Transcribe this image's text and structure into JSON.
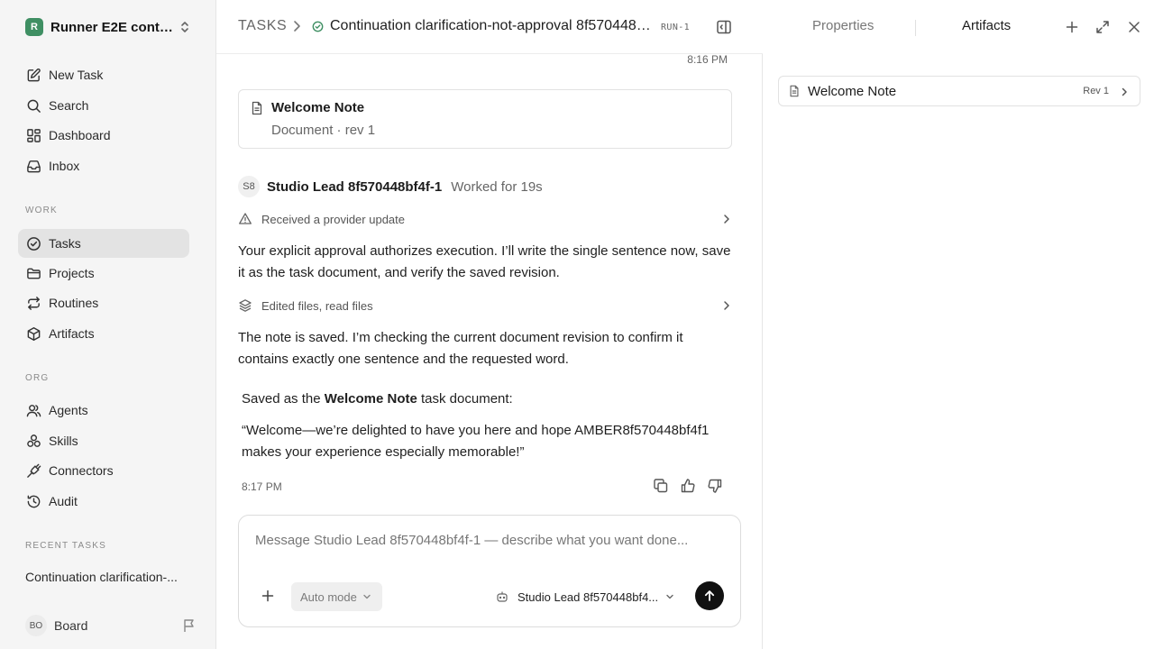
{
  "sidebar": {
    "workspace": {
      "logo": "R",
      "name": "Runner E2E conti..."
    },
    "primary": [
      {
        "label": "New Task",
        "icon": "edit-icon"
      },
      {
        "label": "Search",
        "icon": "search-icon"
      },
      {
        "label": "Dashboard",
        "icon": "dashboard-icon"
      },
      {
        "label": "Inbox",
        "icon": "inbox-icon"
      }
    ],
    "work_label": "WORK",
    "work": [
      {
        "label": "Tasks",
        "icon": "check-circle-icon",
        "active": true
      },
      {
        "label": "Projects",
        "icon": "folder-icon"
      },
      {
        "label": "Routines",
        "icon": "repeat-icon"
      },
      {
        "label": "Artifacts",
        "icon": "cube-icon"
      }
    ],
    "org_label": "ORG",
    "org": [
      {
        "label": "Agents",
        "icon": "users-icon"
      },
      {
        "label": "Skills",
        "icon": "skills-icon"
      },
      {
        "label": "Connectors",
        "icon": "plug-icon"
      },
      {
        "label": "Audit",
        "icon": "history-icon"
      }
    ],
    "recent_label": "RECENT TASKS",
    "recent": [
      "Continuation clarification-..."
    ],
    "user": {
      "initials": "BO",
      "name": "Board"
    }
  },
  "topbar": {
    "root": "TASKS",
    "title": "Continuation clarification-not-approval 8f570448bf4...",
    "run_badge": "RUN-1"
  },
  "thread": {
    "time_top": "8:16 PM",
    "doc_card": {
      "title": "Welcome Note",
      "meta": "Document · rev 1"
    },
    "agent": {
      "initials": "S8",
      "name": "Studio Lead 8f570448bf4f-1",
      "worked": "Worked for 19s"
    },
    "event1": "Received a provider update",
    "para1": "Your explicit approval authorizes execution. I’ll write the single sentence now, save it as the task document, and verify the saved revision.",
    "event2": "Edited files, read files",
    "para2": "The note is saved. I’m checking the current document revision to confirm it contains exactly one sentence and the requested word.",
    "saved_prefix": "Saved as the ",
    "saved_bold": "Welcome Note",
    "saved_suffix": " task document:",
    "quote": "“Welcome—we’re delighted to have you here and hope AMBER8f570448bf4f1 makes your experience especially memorable!”",
    "time_bottom": "8:17 PM"
  },
  "composer": {
    "placeholder": "Message Studio Lead 8f570448bf4f-1 — describe what you want done...",
    "mode": "Auto mode",
    "agent": "Studio Lead 8f570448bf4..."
  },
  "right_panel": {
    "tabs": [
      "Properties",
      "Artifacts"
    ],
    "active_tab": "Artifacts",
    "artifact": {
      "name": "Welcome Note",
      "rev": "Rev 1"
    }
  },
  "colors": {
    "accent_green": "#3f8f63",
    "send_button": "#111111"
  }
}
